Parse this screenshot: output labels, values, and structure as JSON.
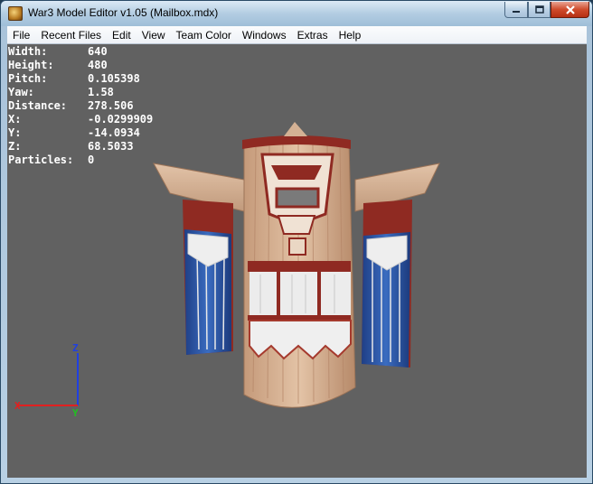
{
  "window": {
    "title": "War3 Model Editor v1.05 (Mailbox.mdx)",
    "min_icon": "minimize-icon",
    "max_icon": "maximize-icon",
    "close_icon": "close-icon",
    "app_icon": "app-icon"
  },
  "menu": {
    "items": [
      "File",
      "Recent Files",
      "Edit",
      "View",
      "Team Color",
      "Windows",
      "Extras",
      "Help"
    ]
  },
  "info": {
    "rows": [
      {
        "key": "Width:",
        "value": "640"
      },
      {
        "key": "Height:",
        "value": "480"
      },
      {
        "key": "Pitch:",
        "value": "0.105398"
      },
      {
        "key": "Yaw:",
        "value": "1.58"
      },
      {
        "key": "Distance:",
        "value": "278.506"
      },
      {
        "key": "X:",
        "value": "-0.0299909"
      },
      {
        "key": "Y:",
        "value": "-14.0934"
      },
      {
        "key": "Z:",
        "value": "68.5033"
      },
      {
        "key": "Particles:",
        "value": "0"
      }
    ]
  },
  "axes": {
    "x_label": "X",
    "y_label": "Y",
    "z_label": "Z",
    "x_color": "#e02020",
    "y_color": "#20c020",
    "z_color": "#2040e0"
  },
  "colors": {
    "viewport_bg": "#616161",
    "wood": "#dcb89a",
    "wood_dark": "#a9795a",
    "red_trim": "#8f2a22",
    "blue_cloth": "#2f5fae",
    "white_cloth": "#eeeeee"
  }
}
